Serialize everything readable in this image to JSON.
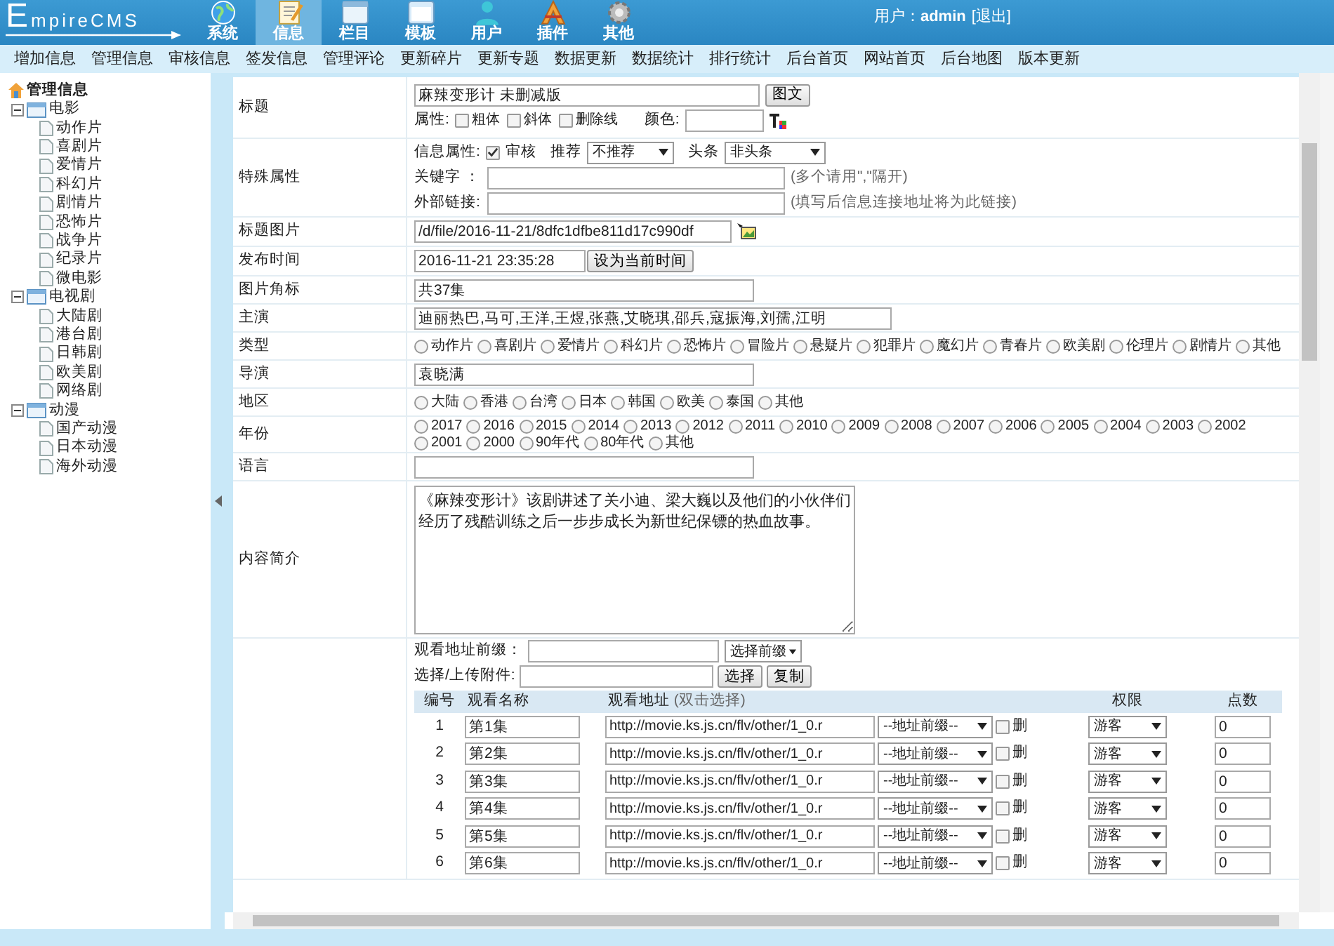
{
  "header": {
    "logo": "EmpireCMS",
    "nav": [
      {
        "label": "系统",
        "selected": false
      },
      {
        "label": "信息",
        "selected": true
      },
      {
        "label": "栏目",
        "selected": false
      },
      {
        "label": "模板",
        "selected": false
      },
      {
        "label": "用户",
        "selected": false
      },
      {
        "label": "插件",
        "selected": false
      },
      {
        "label": "其他",
        "selected": false
      }
    ],
    "user_label": "用户：",
    "user": "admin",
    "logout": "[退出]"
  },
  "submenu": [
    "增加信息",
    "管理信息",
    "审核信息",
    "签发信息",
    "管理评论",
    "更新碎片",
    "更新专题",
    "数据更新",
    "数据统计",
    "排行统计",
    "后台首页",
    "网站首页",
    "后台地图",
    "版本更新"
  ],
  "sidebar": {
    "title": "管理信息",
    "tree": [
      {
        "label": "电影",
        "expanded": true,
        "children": [
          {
            "label": "动作片"
          },
          {
            "label": "喜剧片"
          },
          {
            "label": "爱情片"
          },
          {
            "label": "科幻片"
          },
          {
            "label": "剧情片"
          },
          {
            "label": "恐怖片"
          },
          {
            "label": "战争片"
          },
          {
            "label": "纪录片"
          },
          {
            "label": "微电影"
          }
        ]
      },
      {
        "label": "电视剧",
        "expanded": true,
        "children": [
          {
            "label": "大陆剧"
          },
          {
            "label": "港台剧"
          },
          {
            "label": "日韩剧"
          },
          {
            "label": "欧美剧"
          },
          {
            "label": "网络剧"
          }
        ]
      },
      {
        "label": "动漫",
        "expanded": true,
        "children": [
          {
            "label": "国产动漫"
          },
          {
            "label": "日本动漫"
          },
          {
            "label": "海外动漫"
          }
        ]
      }
    ]
  },
  "form": {
    "rows": [
      {
        "kind": "title",
        "label": "标题",
        "value": "麻辣变形计 未删减版",
        "button": "图文",
        "attr_label": "属性:",
        "options": [
          {
            "label": "粗体",
            "checked": false
          },
          {
            "label": "斜体",
            "checked": false
          },
          {
            "label": "删除线",
            "checked": false
          }
        ],
        "color_label": "颜色:"
      },
      {
        "kind": "special",
        "label": "特殊属性",
        "info_label": "信息属性:",
        "review": {
          "label": "审核",
          "checked": true
        },
        "recommend_label": "推荐",
        "recommend_value": "不推荐",
        "headline_label": "头条",
        "headline_value": "非头条",
        "keyword_label": "关键字 ：",
        "keyword_hint": "(多个请用\",\"隔开)",
        "link_label": "外部链接:",
        "link_hint": "(填写后信息连接地址将为此链接)"
      },
      {
        "kind": "image",
        "label": "标题图片",
        "value": "/d/file/2016-11-21/8dfc1dfbe811d17c990df"
      },
      {
        "kind": "datetime",
        "label": "发布时间",
        "value": "2016-11-21 23:35:28",
        "button": "设为当前时间"
      },
      {
        "kind": "text",
        "label": "图片角标",
        "value": "共37集"
      },
      {
        "kind": "text",
        "label": "主演",
        "value": "迪丽热巴,马可,王洋,王煜,张燕,艾晓琪,邵兵,寇振海,刘孺,江明"
      },
      {
        "kind": "radio",
        "label": "类型",
        "options": [
          {
            "label": "动作片",
            "selected": false
          },
          {
            "label": "喜剧片",
            "selected": false
          },
          {
            "label": "爱情片",
            "selected": false
          },
          {
            "label": "科幻片",
            "selected": false
          },
          {
            "label": "恐怖片",
            "selected": false
          },
          {
            "label": "冒险片",
            "selected": false
          },
          {
            "label": "悬疑片",
            "selected": false
          },
          {
            "label": "犯罪片",
            "selected": false
          },
          {
            "label": "魔幻片",
            "selected": false
          },
          {
            "label": "青春片",
            "selected": false
          },
          {
            "label": "欧美剧",
            "selected": false
          },
          {
            "label": "伦理片",
            "selected": false
          },
          {
            "label": "剧情片",
            "selected": false
          },
          {
            "label": "其他",
            "selected": false
          }
        ]
      },
      {
        "kind": "text",
        "label": "导演",
        "value": "袁晓满"
      },
      {
        "kind": "radio",
        "label": "地区",
        "options": [
          {
            "label": "大陆",
            "selected": false
          },
          {
            "label": "香港",
            "selected": false
          },
          {
            "label": "台湾",
            "selected": false
          },
          {
            "label": "日本",
            "selected": false
          },
          {
            "label": "韩国",
            "selected": false
          },
          {
            "label": "欧美",
            "selected": false
          },
          {
            "label": "泰国",
            "selected": false
          },
          {
            "label": "其他",
            "selected": false
          }
        ]
      },
      {
        "kind": "radio",
        "label": "年份",
        "options": [
          {
            "label": "2017",
            "selected": false
          },
          {
            "label": "2016",
            "selected": false
          },
          {
            "label": "2015",
            "selected": false
          },
          {
            "label": "2014",
            "selected": false
          },
          {
            "label": "2013",
            "selected": false
          },
          {
            "label": "2012",
            "selected": false
          },
          {
            "label": "2011",
            "selected": false
          },
          {
            "label": "2010",
            "selected": false
          },
          {
            "label": "2009",
            "selected": false
          },
          {
            "label": "2008",
            "selected": false
          },
          {
            "label": "2007",
            "selected": false
          },
          {
            "label": "2006",
            "selected": false
          },
          {
            "label": "2005",
            "selected": false
          },
          {
            "label": "2004",
            "selected": false
          },
          {
            "label": "2003",
            "selected": false
          },
          {
            "label": "2002",
            "selected": false
          },
          {
            "label": "2001",
            "selected": false
          },
          {
            "label": "2000",
            "selected": false
          },
          {
            "label": "90年代",
            "selected": false
          },
          {
            "label": "80年代",
            "selected": false
          },
          {
            "label": "其他",
            "selected": false
          }
        ]
      },
      {
        "kind": "text",
        "label": "语言"
      },
      {
        "kind": "textarea",
        "label": "内容简介",
        "value": "《麻辣变形计》该剧讲述了关小迪、梁大巍以及他们的小伙伴们经历了残酷训练之后一步步成长为新世纪保镖的热血故事。"
      },
      {
        "kind": "play",
        "prefix_label": "观看地址前缀：",
        "prefix_select": "选择前缀",
        "upload_label": "选择/上传附件:",
        "buttons": [
          "选择",
          "复制"
        ],
        "columns": [
          {
            "label": "编号"
          },
          {
            "label": "观看名称"
          },
          {
            "label": "观看地址",
            "hint": "(双击选择)"
          },
          {
            "label": "权限"
          },
          {
            "label": "点数"
          }
        ],
        "episodes": [
          {
            "number": "1",
            "name": "第1集",
            "url": "http://movie.ks.js.cn/flv/other/1_0.r",
            "prefix": "--地址前缀--",
            "delete": {
              "label": "删",
              "checked": false
            },
            "permission": "游客",
            "points": "0"
          },
          {
            "number": "2",
            "name": "第2集",
            "url": "http://movie.ks.js.cn/flv/other/1_0.r",
            "prefix": "--地址前缀--",
            "delete": {
              "label": "删",
              "checked": false
            },
            "permission": "游客",
            "points": "0"
          },
          {
            "number": "3",
            "name": "第3集",
            "url": "http://movie.ks.js.cn/flv/other/1_0.r",
            "prefix": "--地址前缀--",
            "delete": {
              "label": "删",
              "checked": false
            },
            "permission": "游客",
            "points": "0"
          },
          {
            "number": "4",
            "name": "第4集",
            "url": "http://movie.ks.js.cn/flv/other/1_0.r",
            "prefix": "--地址前缀--",
            "delete": {
              "label": "删",
              "checked": false
            },
            "permission": "游客",
            "points": "0"
          },
          {
            "number": "5",
            "name": "第5集",
            "url": "http://movie.ks.js.cn/flv/other/1_0.r",
            "prefix": "--地址前缀--",
            "delete": {
              "label": "删",
              "checked": false
            },
            "permission": "游客",
            "points": "0"
          },
          {
            "number": "6",
            "name": "第6集",
            "url": "http://movie.ks.js.cn/flv/other/1_0.r",
            "prefix": "--地址前缀--",
            "delete": {
              "label": "删",
              "checked": false
            },
            "permission": "游客",
            "points": "0"
          }
        ]
      }
    ]
  }
}
